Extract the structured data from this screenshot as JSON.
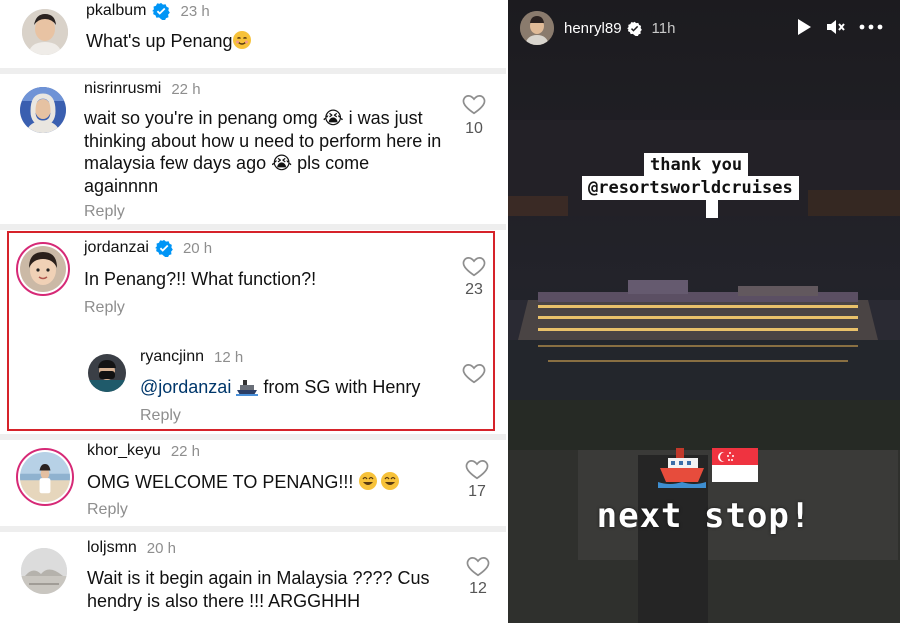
{
  "comments_panel": {
    "comments": [
      {
        "username": "pkalbum",
        "verified": true,
        "time": "23 h",
        "text": "What's up Penang",
        "emoji": "smiling-face",
        "avatar": "man-avatar"
      },
      {
        "username": "nisrinrusmi",
        "verified": false,
        "time": "22 h",
        "text": "wait so you're in penang omg 😭 i was just thinking about how u need to perform here in malaysia few days ago 😭 pls come againnnn",
        "likes": "10",
        "reply_label": "Reply"
      },
      {
        "username": "jordanzai",
        "verified": true,
        "time": "20 h",
        "text": "In Penang?!! What function?!",
        "likes": "23",
        "reply_label": "Reply"
      },
      {
        "username": "ryancjinn",
        "verified": false,
        "time": "12 h",
        "mention": "@jordanzai",
        "text": "from SG with Henry",
        "emoji": "ship",
        "reply_label": "Reply"
      },
      {
        "username": "khor_keyu",
        "verified": false,
        "time": "22 h",
        "text": "OMG WELCOME TO PENANG!!!",
        "emoji": "grinning-faces",
        "likes": "17",
        "reply_label": "Reply"
      },
      {
        "username": "loljsmn",
        "verified": false,
        "time": "20 h",
        "text": "Wait is it begin again in Malaysia ???? Cus hendry is also there !!! ARGGHHH",
        "likes": "12"
      }
    ],
    "highlight_color": "#d6232a"
  },
  "story": {
    "username": "henryl89",
    "verified": true,
    "time": "11h",
    "caption_line1": "thank you",
    "caption_line2": "@resortsworldcruises",
    "bottom_text": "next stop!",
    "stickers": [
      "ship-emoji",
      "singapore-flag-emoji"
    ],
    "controls": [
      "play-icon",
      "mute-icon",
      "more-icon"
    ]
  },
  "colors": {
    "verified_blue": "#0095f6",
    "muted_text": "#8e8e8e",
    "mention_blue": "#00376b"
  }
}
